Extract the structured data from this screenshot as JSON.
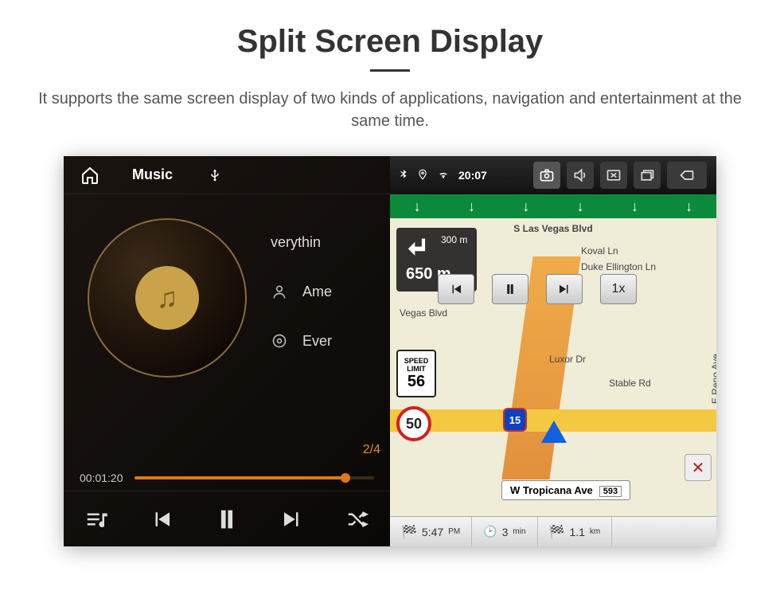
{
  "page": {
    "title": "Split Screen Display",
    "description": "It supports the same screen display of two kinds of applications, navigation and entertainment at the same time."
  },
  "music": {
    "header_title": "Music",
    "tracks": {
      "now_playing_partial": "verythin",
      "artist_partial": "Ame",
      "album_partial": "Ever"
    },
    "track_index": "2/4",
    "elapsed": "00:01:20"
  },
  "status": {
    "time": "20:07"
  },
  "nav": {
    "top_street": "S Las Vegas Blvd",
    "koval": "Koval Ln",
    "duke": "Duke Ellington Ln",
    "vegas_blvd": "Vegas Blvd",
    "luxor": "Luxor Dr",
    "stable": "Stable Rd",
    "reno": "E Reno Ave",
    "bottom_street": "W Tropicana Ave",
    "bottom_street_num": "593",
    "turn_small": "300 m",
    "turn_big": "650 m",
    "speed_limit_label1": "SPEED",
    "speed_limit_label2": "LIMIT",
    "speed_limit_value": "56",
    "current_speed": "50",
    "highway": "15",
    "playback_speed": "1x",
    "eta": "5:47",
    "eta_unit": "PM",
    "remaining_time": "3",
    "remaining_time_unit": "min",
    "remaining_dist": "1.1",
    "remaining_dist_unit": "km"
  }
}
